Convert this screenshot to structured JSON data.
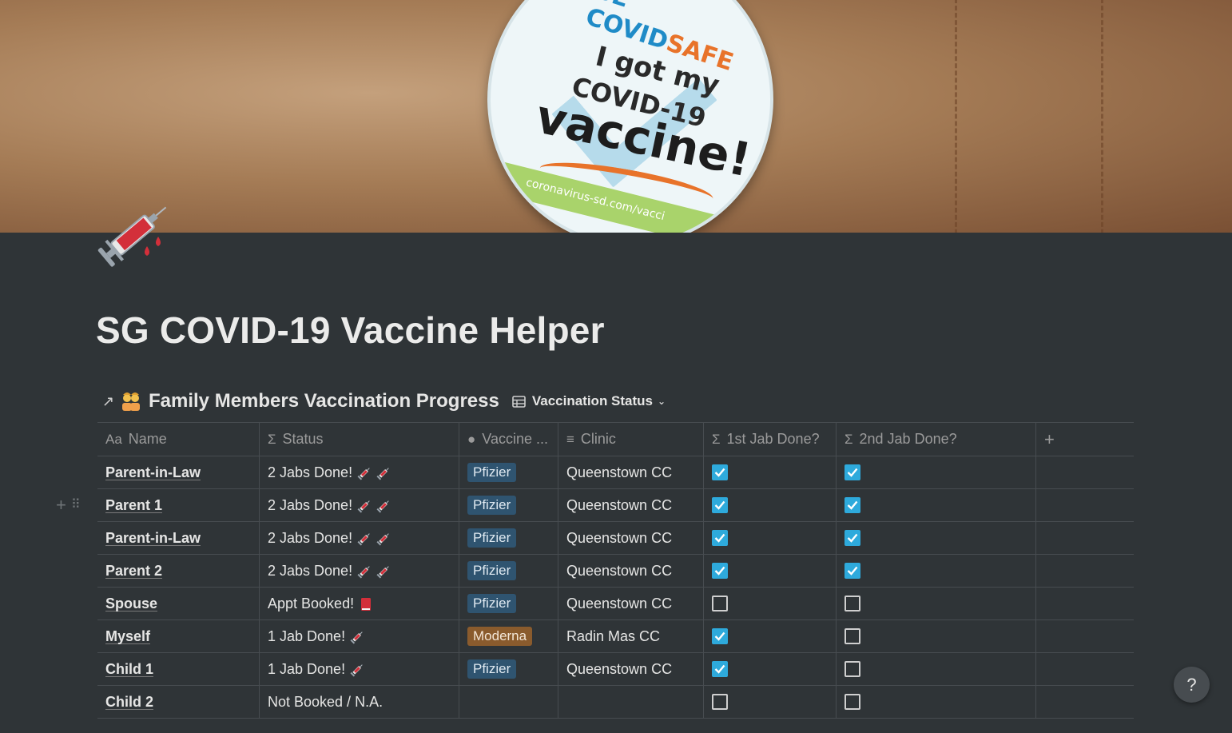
{
  "cover": {
    "sticker_line1a": "BE COVID",
    "sticker_line1b": "SAFE",
    "sticker_line2": "I got my",
    "sticker_line3": "COVID-19",
    "sticker_line4": "vaccine!",
    "sticker_url": "coronavirus-sd.com/vacci"
  },
  "page": {
    "icon": "syringe-icon",
    "title": "SG COVID-19 Vaccine Helper"
  },
  "database": {
    "link_icon": "arrow-up-right-icon",
    "emoji_icon": "people-icon",
    "title": "Family Members Vaccination Progress",
    "view_icon": "table-icon",
    "view_label": "Vaccination Status",
    "columns": [
      {
        "icon": "Aa",
        "label": "Name"
      },
      {
        "icon": "Σ",
        "label": "Status"
      },
      {
        "icon": "●",
        "label": "Vaccine ..."
      },
      {
        "icon": "≡",
        "label": "Clinic"
      },
      {
        "icon": "Σ",
        "label": "1st Jab Done?"
      },
      {
        "icon": "Σ",
        "label": "2nd Jab Done?"
      },
      {
        "icon": "",
        "label": "+"
      }
    ],
    "rows": [
      {
        "name": "Parent-in-Law",
        "status": "2 Jabs Done!",
        "status_icon": "syringe-x2",
        "vaccine": "Pfizier",
        "vaccine_color": "#2f5470",
        "clinic": "Queenstown CC",
        "jab1": true,
        "jab2": true
      },
      {
        "name": "Parent 1",
        "status": "2 Jabs Done!",
        "status_icon": "syringe-x2",
        "vaccine": "Pfizier",
        "vaccine_color": "#2f5470",
        "clinic": "Queenstown CC",
        "jab1": true,
        "jab2": true
      },
      {
        "name": "Parent-in-Law",
        "status": "2 Jabs Done!",
        "status_icon": "syringe-x2",
        "vaccine": "Pfizier",
        "vaccine_color": "#2f5470",
        "clinic": "Queenstown CC",
        "jab1": true,
        "jab2": true
      },
      {
        "name": "Parent 2",
        "status": "2 Jabs Done!",
        "status_icon": "syringe-x2",
        "vaccine": "Pfizier",
        "vaccine_color": "#2f5470",
        "clinic": "Queenstown CC",
        "jab1": true,
        "jab2": true
      },
      {
        "name": "Spouse",
        "status": "Appt Booked!",
        "status_icon": "red-book",
        "vaccine": "Pfizier",
        "vaccine_color": "#2f5470",
        "clinic": "Queenstown CC",
        "jab1": false,
        "jab2": false
      },
      {
        "name": "Myself",
        "status": "1 Jab Done!",
        "status_icon": "syringe-x1",
        "vaccine": "Moderna",
        "vaccine_color": "#8a5b2d",
        "clinic": "Radin Mas CC",
        "jab1": true,
        "jab2": false
      },
      {
        "name": "Child 1",
        "status": "1 Jab Done!",
        "status_icon": "syringe-x1",
        "vaccine": "Pfizier",
        "vaccine_color": "#2f5470",
        "clinic": "Queenstown CC",
        "jab1": true,
        "jab2": false
      },
      {
        "name": "Child 2",
        "status": "Not Booked / N.A.",
        "status_icon": "",
        "vaccine": "",
        "vaccine_color": "",
        "clinic": "",
        "jab1": false,
        "jab2": false
      }
    ]
  },
  "help_label": "?",
  "colors": {
    "background": "#2f3437",
    "checkbox": "#2eaadc",
    "grid": "#474c50"
  }
}
